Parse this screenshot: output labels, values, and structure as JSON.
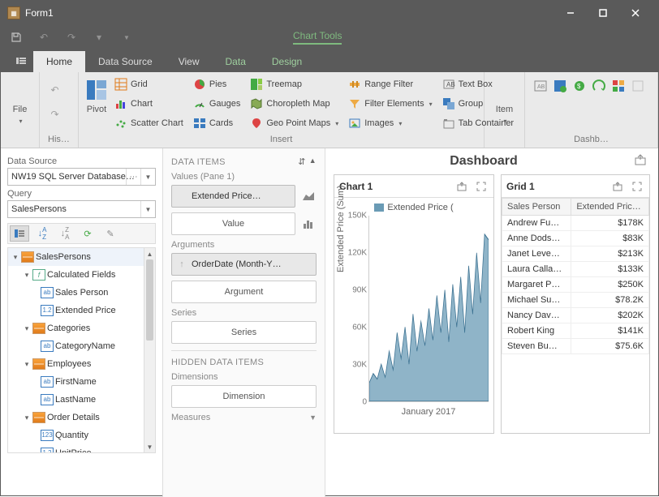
{
  "window": {
    "title": "Form1"
  },
  "quickbar": {
    "chart_tools": "Chart Tools"
  },
  "tabs": {
    "home": "Home",
    "datasource": "Data Source",
    "view": "View",
    "data": "Data",
    "design": "Design"
  },
  "ribbon": {
    "file": "File",
    "history": "His…",
    "pivot": "Pivot",
    "insert_label": "Insert",
    "item": "Item",
    "dashboard": "Dashb…",
    "grid": "Grid",
    "chart": "Chart",
    "scatter": "Scatter Chart",
    "pies": "Pies",
    "gauges": "Gauges",
    "cards": "Cards",
    "treemap": "Treemap",
    "choropleth": "Choropleth Map",
    "geopoint": "Geo Point Maps",
    "rangefilter": "Range Filter",
    "filterelem": "Filter Elements",
    "images": "Images",
    "textbox": "Text Box",
    "group": "Group",
    "tabcontainer": "Tab Container"
  },
  "left": {
    "datasource_label": "Data Source",
    "datasource_value": "NW19 SQL Server Database…",
    "query_label": "Query",
    "query_value": "SalesPersons",
    "tree": {
      "root": "SalesPersons",
      "calculated": "Calculated Fields",
      "salesperson": "Sales Person",
      "extprice": "Extended Price",
      "categories": "Categories",
      "categoryname": "CategoryName",
      "employees": "Employees",
      "firstname": "FirstName",
      "lastname": "LastName",
      "orderdetails": "Order Details",
      "quantity": "Quantity",
      "unitprice": "UnitPrice"
    }
  },
  "middle": {
    "dataitems": "DATA ITEMS",
    "valuespane": "Values (Pane 1)",
    "extprice": "Extended Price…",
    "value": "Value",
    "arguments": "Arguments",
    "orderdate": "OrderDate (Month-Y…",
    "argument": "Argument",
    "series_label": "Series",
    "series": "Series",
    "hidden": "HIDDEN DATA ITEMS",
    "dimensions": "Dimensions",
    "dimension": "Dimension",
    "measures": "Measures"
  },
  "dashboard": {
    "title": "Dashboard",
    "chart_title": "Chart 1",
    "grid_title": "Grid 1",
    "legend": "Extended Price (",
    "ylabel": "Extended Price (Sum)",
    "xlabel": "January 2017",
    "grid_cols": {
      "c1": "Sales Person",
      "c2": "Extended Price …"
    },
    "grid_rows": [
      {
        "name": "Andrew Fu…",
        "val": "$178K"
      },
      {
        "name": "Anne Dods…",
        "val": "$83K"
      },
      {
        "name": "Janet Leve…",
        "val": "$213K"
      },
      {
        "name": "Laura Calla…",
        "val": "$133K"
      },
      {
        "name": "Margaret P…",
        "val": "$250K"
      },
      {
        "name": "Michael Su…",
        "val": "$78.2K"
      },
      {
        "name": "Nancy Dav…",
        "val": "$202K"
      },
      {
        "name": "Robert King",
        "val": "$141K"
      },
      {
        "name": "Steven Bu…",
        "val": "$75.6K"
      }
    ]
  },
  "chart_data": {
    "type": "area",
    "title": "Chart 1",
    "ylabel": "Extended Price (Sum)",
    "xlabel": "January 2017",
    "ylim": [
      0,
      150000
    ],
    "yticks": [
      0,
      30000,
      60000,
      90000,
      120000,
      150000
    ],
    "ytick_labels": [
      "0",
      "30K",
      "60K",
      "90K",
      "120K",
      "150K"
    ],
    "series": [
      {
        "name": "Extended Price (Sum)",
        "values": [
          15000,
          22000,
          18000,
          30000,
          20000,
          40000,
          25000,
          55000,
          35000,
          60000,
          30000,
          70000,
          40000,
          65000,
          45000,
          75000,
          50000,
          85000,
          55000,
          90000,
          48000,
          95000,
          60000,
          100000,
          55000,
          110000,
          70000,
          120000,
          80000,
          135000,
          90000,
          130000
        ]
      }
    ]
  }
}
